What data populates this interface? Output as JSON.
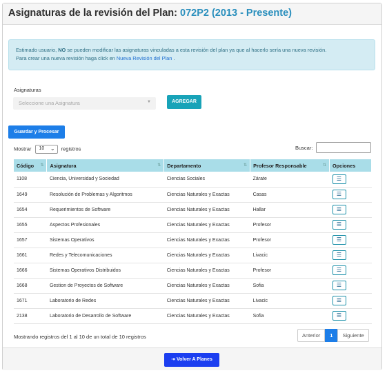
{
  "header": {
    "title": "Asignaturas de la revisión del Plan:",
    "plan_code": "072P2 (2013 - Presente)"
  },
  "alert": {
    "line1_pre": "Estimado usuario, ",
    "line1_bold": "NO",
    "line1_post": " se pueden modificar las asignaturas vinculadas a esta revisión del plan ya que al hacerlo sería una nueva revisión.",
    "line2_pre": "Para crear una nueva revisión haga click en ",
    "line2_link": "Nueva Revisión del Plan",
    "line2_post": " ."
  },
  "form": {
    "asignaturas_label": "Asignaturas",
    "select_placeholder": "Seleccione una Asignatura",
    "agregar_label": "AGREGAR",
    "guardar_label": "Guardar y Procesar"
  },
  "table_controls": {
    "mostrar_label": "Mostrar",
    "page_size": "10",
    "registros_label": "registros",
    "buscar_label": "Buscar:",
    "search_value": ""
  },
  "table": {
    "columns": [
      "Código",
      "Asignatura",
      "Departamento",
      "Profesor Responsable",
      "Opciones"
    ],
    "rows": [
      {
        "codigo": "1108",
        "asignatura": "Ciencia, Universidad y Sociedad",
        "departamento": "Ciencias Sociales",
        "profesor": "Zárate"
      },
      {
        "codigo": "1649",
        "asignatura": "Resolución de Problemas y Algoritmos",
        "departamento": "Ciencias Naturales y Exactas",
        "profesor": "Casas"
      },
      {
        "codigo": "1654",
        "asignatura": "Requerimientos de Software",
        "departamento": "Ciencias Naturales y Exactas",
        "profesor": "Hallar"
      },
      {
        "codigo": "1655",
        "asignatura": "Aspectos Profesionales",
        "departamento": "Ciencias Naturales y Exactas",
        "profesor": "Profesor"
      },
      {
        "codigo": "1657",
        "asignatura": "Sistemas Operativos",
        "departamento": "Ciencias Naturales y Exactas",
        "profesor": "Profesor"
      },
      {
        "codigo": "1661",
        "asignatura": "Redes y Telecomunicaciones",
        "departamento": "Ciencias Naturales y Exactas",
        "profesor": "Livacic"
      },
      {
        "codigo": "1666",
        "asignatura": "Sistemas Operativos Distribuidos",
        "departamento": "Ciencias Naturales y Exactas",
        "profesor": "Profesor"
      },
      {
        "codigo": "1668",
        "asignatura": "Gestion de Proyectos de Software",
        "departamento": "Ciencias Naturales y Exactas",
        "profesor": "Sofia"
      },
      {
        "codigo": "1671",
        "asignatura": "Laboratorio de Redes",
        "departamento": "Ciencias Naturales y Exactas",
        "profesor": "Livacic"
      },
      {
        "codigo": "2138",
        "asignatura": "Laboratorio de Desarrollo de Software",
        "departamento": "Ciencias Naturales y Exactas",
        "profesor": "Sofia"
      }
    ],
    "options_icon": "list-icon"
  },
  "footer_info": {
    "info_text": "Mostrando registros del 1 al 10 de un total de 10 registros",
    "prev_label": "Anterior",
    "current_page": "1",
    "next_label": "Siguiente"
  },
  "footer": {
    "volver_label": "Volver A Planes",
    "volver_icon": "exit-icon"
  },
  "colors": {
    "accent": "#1d7ee8",
    "info_button": "#18a3b8",
    "table_header": "#a9dde8",
    "volver_button": "#1b3ef0",
    "plan_code": "#2a8fbd"
  }
}
